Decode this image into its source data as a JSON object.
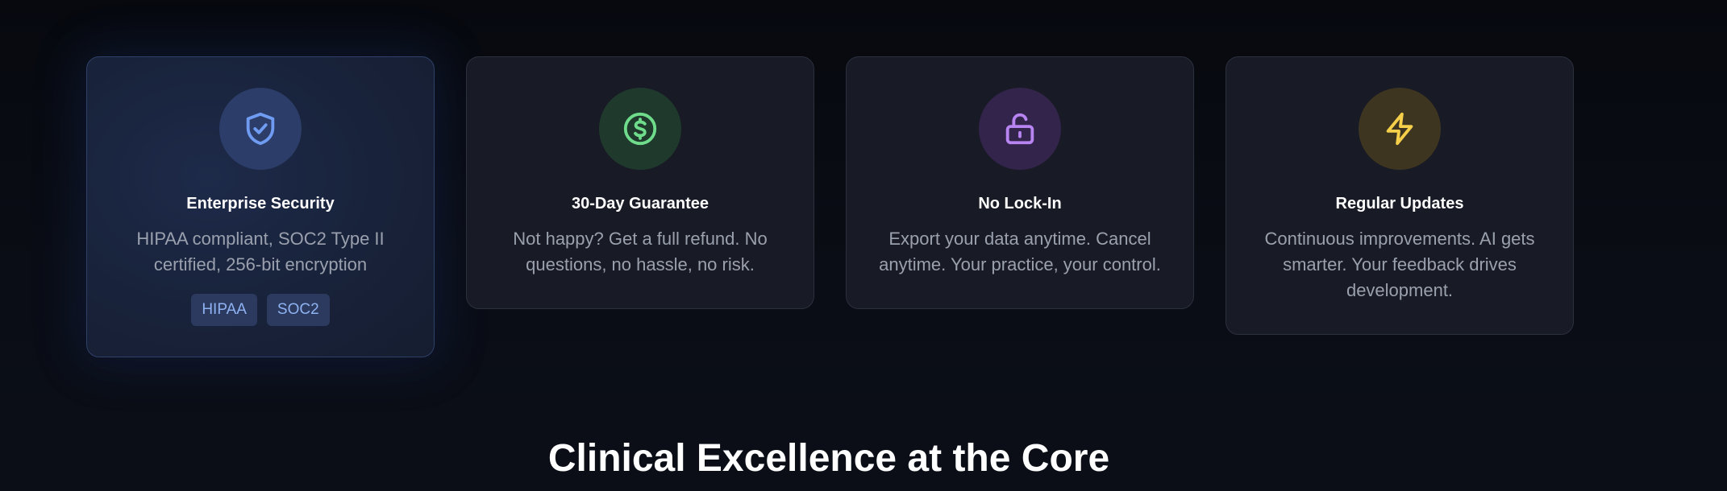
{
  "cards": [
    {
      "title": "Enterprise Security",
      "description": "HIPAA compliant, SOC2 Type II certified, 256-bit encryption",
      "icon": "shield-check-icon",
      "icon_color": "#6f9cf2",
      "icon_bg": "#2b3d68",
      "badges": [
        "HIPAA",
        "SOC2"
      ]
    },
    {
      "title": "30-Day Guarantee",
      "description": "Not happy? Get a full refund. No questions, no hassle, no risk.",
      "icon": "dollar-circle-icon",
      "icon_color": "#6edc8b",
      "icon_bg": "#1f3a2c"
    },
    {
      "title": "No Lock-In",
      "description": "Export your data anytime. Cancel anytime. Your practice, your control.",
      "icon": "unlocked-padlock-icon",
      "icon_color": "#b784f2",
      "icon_bg": "#33244c"
    },
    {
      "title": "Regular Updates",
      "description": "Continuous improvements. AI gets smarter. Your feedback drives development.",
      "icon": "lightning-bolt-icon",
      "icon_color": "#f5cf4a",
      "icon_bg": "#3e3520"
    }
  ],
  "section": {
    "title": "Clinical Excellence at the Core"
  }
}
